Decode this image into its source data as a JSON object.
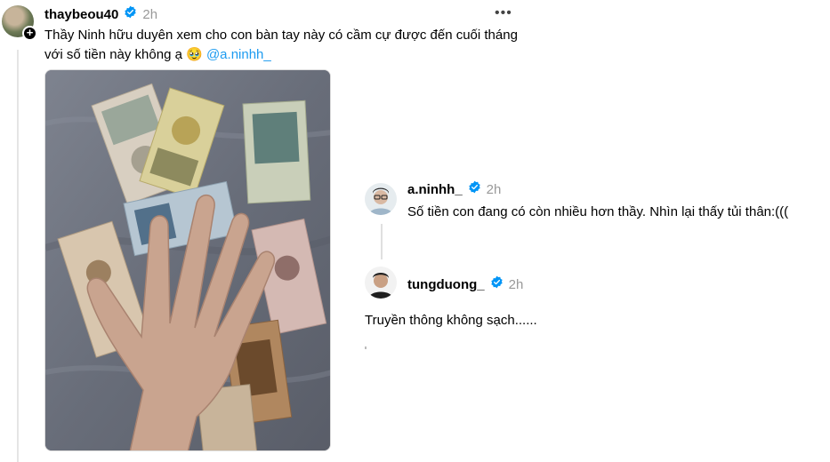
{
  "main_post": {
    "username": "thaybeou40",
    "time": "2h",
    "text_before_mention": "Thầy Ninh hữu duyên xem cho con bàn tay này có cầm cự được đến cuối tháng với số tiền này không ạ 🥹 ",
    "mention": "@a.ninhh_"
  },
  "replies": [
    {
      "username": "a.ninhh_",
      "time": "2h",
      "text": "Số tiền con đang có còn nhiều hơn thầy. Nhìn lại thấy tủi thân:((("
    },
    {
      "username": "tungduong_",
      "time": "2h",
      "text": "Truyền thông không sạch......"
    }
  ],
  "icons": {
    "verified": "verified-badge-icon",
    "more": "more-options-icon",
    "follow": "follow-plus-icon"
  },
  "colors": {
    "verified": "#0095f6",
    "mention": "#1d9bf0",
    "timestamp": "#999999"
  }
}
